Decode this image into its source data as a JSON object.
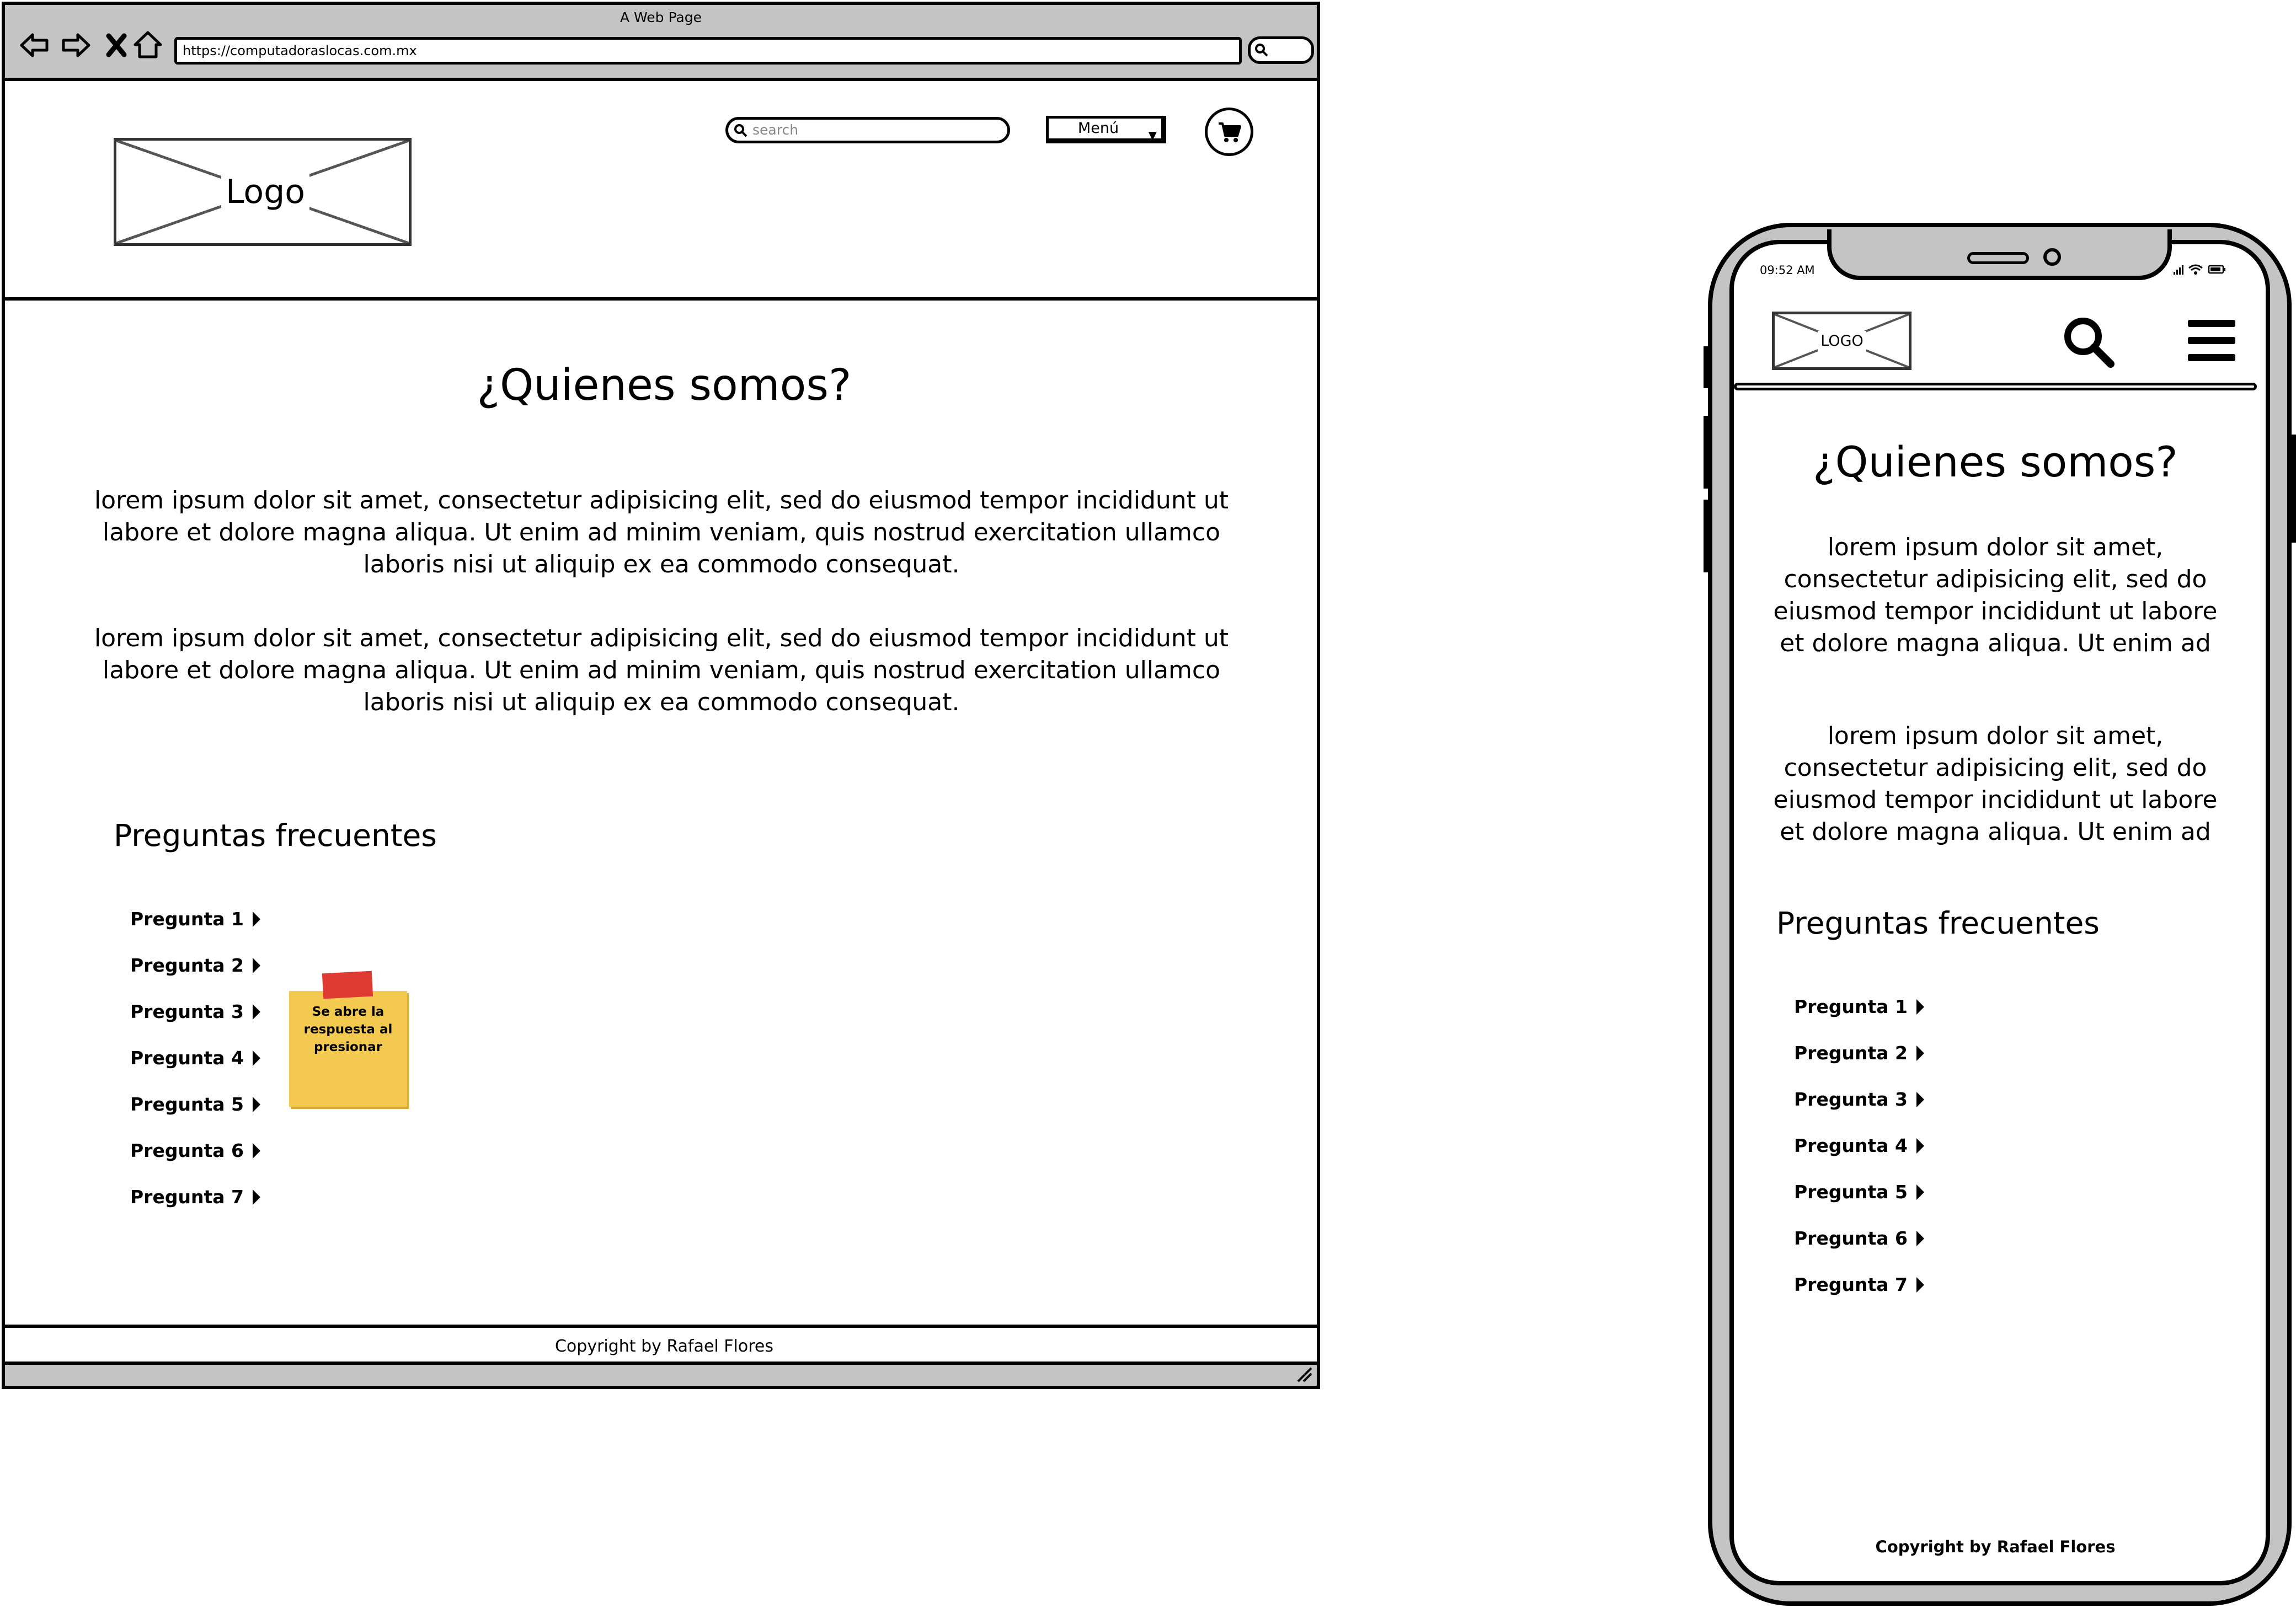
{
  "desktop": {
    "window_title": "A Web Page",
    "url": "https://computadoraslocas.com.mx",
    "logo_text": "Logo",
    "search_placeholder": "search",
    "menu_label": "Menú",
    "title": "¿Quienes somos?",
    "paragraphs": [
      "lorem ipsum dolor sit amet, consectetur adipisicing elit, sed do eiusmod tempor incididunt ut labore et dolore magna aliqua. Ut enim ad minim veniam, quis nostrud exercitation ullamco laboris nisi ut aliquip ex ea commodo consequat.",
      "lorem ipsum dolor sit amet, consectetur adipisicing elit, sed do eiusmod tempor incididunt ut labore et dolore magna aliqua. Ut enim ad minim veniam, quis nostrud exercitation ullamco laboris nisi ut aliquip ex ea commodo consequat."
    ],
    "faq_title": "Preguntas frecuentes",
    "faq_items": [
      "Pregunta 1",
      "Pregunta 2",
      "Pregunta 3",
      "Pregunta 4",
      "Pregunta 5",
      "Pregunta 6",
      "Pregunta 7"
    ],
    "sticky_note": "Se abre la respuesta al presionar",
    "footer": "Copyright by Rafael Flores"
  },
  "mobile": {
    "status_time": "09:52 AM",
    "logo_text": "LOGO",
    "title": "¿Quienes somos?",
    "paragraphs": [
      "lorem ipsum dolor sit amet,\nconsectetur adipisicing elit, sed do\neiusmod tempor incididunt ut labore\net dolore magna aliqua. Ut enim ad",
      "lorem ipsum dolor sit amet,\nconsectetur adipisicing elit, sed do\neiusmod tempor incididunt ut labore\net dolore magna aliqua. Ut enim ad"
    ],
    "faq_title": "Preguntas frecuentes",
    "faq_items": [
      "Pregunta 1",
      "Pregunta 2",
      "Pregunta 3",
      "Pregunta 4",
      "Pregunta 5",
      "Pregunta 6",
      "Pregunta 7"
    ],
    "footer": "Copyright by Rafael Flores"
  },
  "icons": {
    "back": "arrow-left-icon",
    "forward": "arrow-right-icon",
    "stop": "close-icon",
    "home": "home-icon",
    "search": "search-icon",
    "cart": "cart-icon",
    "menu": "hamburger-icon",
    "faq_expand": "caret-right-icon"
  },
  "colors": {
    "chrome_gray": "#c4c4c4",
    "sticky_yellow": "#f3c94f",
    "sticky_tape": "#e03a35"
  }
}
